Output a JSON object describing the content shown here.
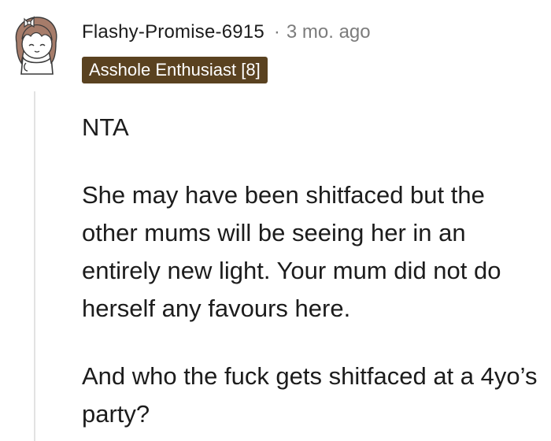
{
  "comment": {
    "avatar_icon": "user-avatar-icon",
    "username": "Flashy-Promise-6915",
    "separator": "·",
    "timestamp": "3 mo. ago",
    "flair": {
      "label": "Asshole Enthusiast [8]",
      "color": "#5a4220"
    },
    "paragraphs": [
      "NTA",
      "She may have been shitfaced but the other mums will be seeing her in an entirely new light. Your mum did not do herself any favours here.",
      "And who the fuck gets shitfaced at a 4yo’s party?"
    ]
  }
}
